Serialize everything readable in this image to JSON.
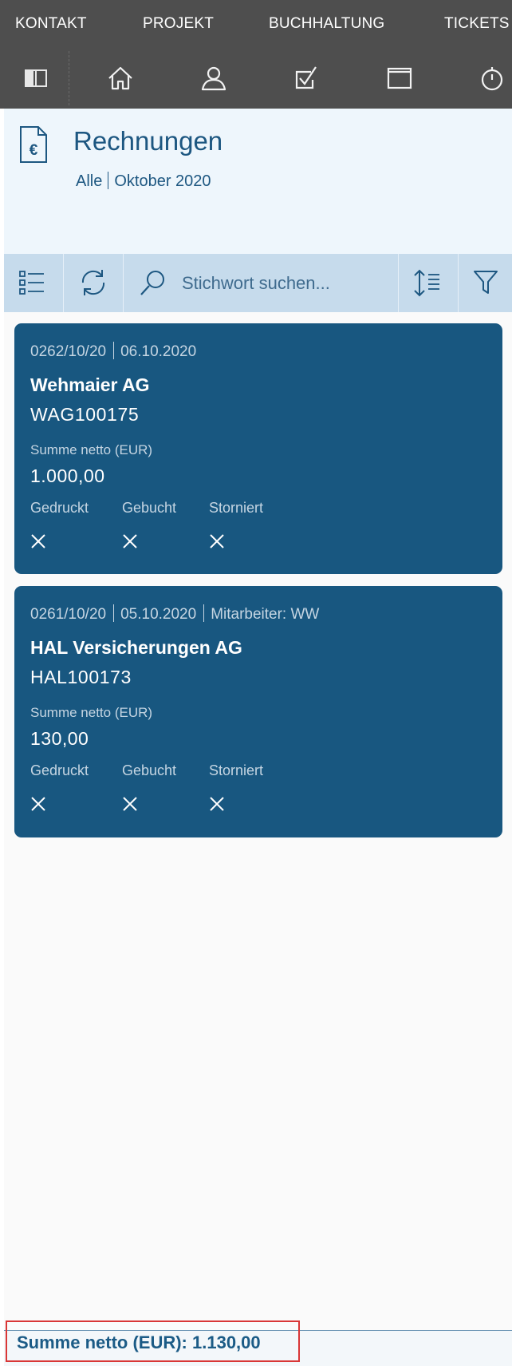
{
  "topnav": {
    "items": [
      {
        "label": "KONTAKT"
      },
      {
        "label": "PROJEKT"
      },
      {
        "label": "BUCHHALTUNG"
      },
      {
        "label": "TICKETS"
      }
    ]
  },
  "iconbar": {
    "icons": [
      "sidebar-toggle-icon",
      "home-icon",
      "user-icon",
      "task-check-icon",
      "window-icon",
      "stopwatch-icon"
    ]
  },
  "header": {
    "icon": "euro-document-icon",
    "title": "Rechnungen",
    "filter_all": "Alle",
    "filter_period": "Oktober 2020"
  },
  "toolbar": {
    "search_placeholder": "Stichwort suchen...",
    "icons": [
      "list-view-icon",
      "refresh-icon",
      "search-icon",
      "sort-icon",
      "filter-icon"
    ]
  },
  "invoices": [
    {
      "number": "0262/10/20",
      "date": "06.10.2020",
      "employee": "",
      "company": "Wehmaier AG",
      "code": "WAG100175",
      "sum_label": "Summe netto (EUR)",
      "sum": "1.000,00",
      "flags": [
        {
          "label": "Gedruckt",
          "value": "×"
        },
        {
          "label": "Gebucht",
          "value": "×"
        },
        {
          "label": "Storniert",
          "value": "×"
        }
      ]
    },
    {
      "number": "0261/10/20",
      "date": "05.10.2020",
      "employee": "Mitarbeiter: WW",
      "company": "HAL Versicherungen AG",
      "code": "HAL100173",
      "sum_label": "Summe netto (EUR)",
      "sum": "130,00",
      "flags": [
        {
          "label": "Gedruckt",
          "value": "×"
        },
        {
          "label": "Gebucht",
          "value": "×"
        },
        {
          "label": "Storniert",
          "value": "×"
        }
      ]
    }
  ],
  "footer": {
    "total": "Summe netto (EUR): 1.130,00"
  },
  "colors": {
    "topbar": "#4e4e4e",
    "card": "#185780",
    "toolbar": "#c6dbec",
    "header_bg": "#eef6fc",
    "highlight": "#d93636"
  }
}
